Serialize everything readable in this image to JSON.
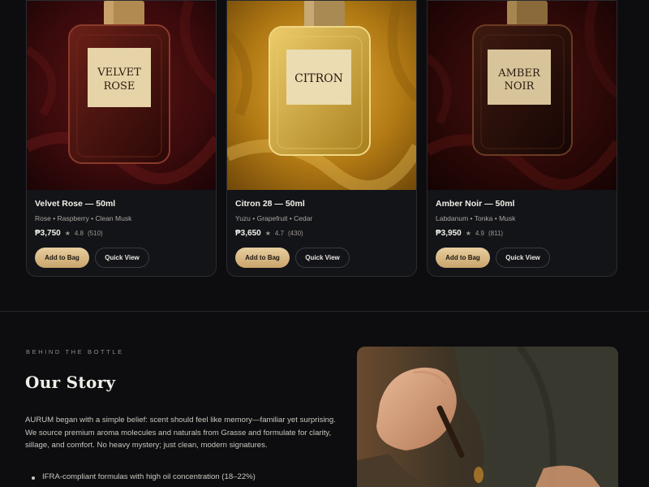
{
  "products": [
    {
      "title": "Velvet Rose — 50ml",
      "notes": "Rose • Raspberry • Clean Musk",
      "price": "₱3,750",
      "rating": "4.8",
      "count": "(510)",
      "label_line1": "VELVET",
      "label_line2": "ROSE",
      "add_label": "Add to Bag",
      "view_label": "Quick View",
      "bg": "#3a0a0c",
      "liquid": "#4a1410"
    },
    {
      "title": "Citron 28 — 50ml",
      "notes": "Yuzu • Grapefruit • Cedar",
      "price": "₱3,650",
      "rating": "4.7",
      "count": "(430)",
      "label_line1": "CITRON",
      "label_line2": "",
      "add_label": "Add to Bag",
      "view_label": "Quick View",
      "bg": "#b27a14",
      "liquid": "#d2aa3a"
    },
    {
      "title": "Amber Noir — 50ml",
      "notes": "Labdanum • Tonka • Musk",
      "price": "₱3,950",
      "rating": "4.9",
      "count": "(811)",
      "label_line1": "AMBER",
      "label_line2": "NOIR",
      "add_label": "Add to Bag",
      "view_label": "Quick View",
      "bg": "#2a0807",
      "liquid": "#2e120a"
    }
  ],
  "story": {
    "eyebrow": "BEHIND THE BOTTLE",
    "title": "Our Story",
    "text": "AURUM began with a simple belief: scent should feel like memory—familiar yet surprising. We source premium aroma molecules and naturals from Grasse and formulate for clarity, sillage, and comfort. No heavy mystery; just clean, modern signatures.",
    "bullets": [
      "IFRA-compliant formulas with high oil concentration (18–22%)"
    ]
  },
  "colors": {
    "accent_gold": "#d9b985",
    "background": "#0d0d0f",
    "card": "#131418"
  }
}
